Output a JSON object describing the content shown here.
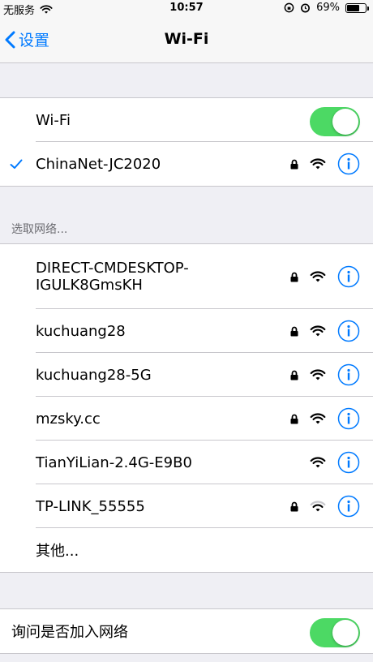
{
  "status_bar": {
    "carrier": "无服务",
    "time": "10:57",
    "battery": "69%",
    "battery_level": 0.69
  },
  "nav": {
    "back_label": "设置",
    "title": "Wi-Fi"
  },
  "wifi_toggle": {
    "label": "Wi-Fi",
    "on": true
  },
  "connected": {
    "name": "ChinaNet-JC2020",
    "secured": true,
    "signal": "full"
  },
  "choose_header": "选取网络...",
  "networks": [
    {
      "name_line1": "DIRECT-CMDESKTOP-",
      "name_line2": "IGULK8GmsKH",
      "secured": true,
      "signal": "full"
    },
    {
      "name": "kuchuang28",
      "secured": true,
      "signal": "full"
    },
    {
      "name": "kuchuang28-5G",
      "secured": true,
      "signal": "full"
    },
    {
      "name": "mzsky.cc",
      "secured": true,
      "signal": "full"
    },
    {
      "name": "TianYiLian-2.4G-E9B0",
      "secured": false,
      "signal": "full"
    },
    {
      "name": "TP-LINK_55555",
      "secured": true,
      "signal": "weak"
    },
    {
      "name": "其他..."
    }
  ],
  "ask_join": {
    "label": "询问是否加入网络",
    "on": true
  },
  "colors": {
    "accent": "#007aff",
    "toggle_on": "#4cd964",
    "background": "#efeff4"
  }
}
